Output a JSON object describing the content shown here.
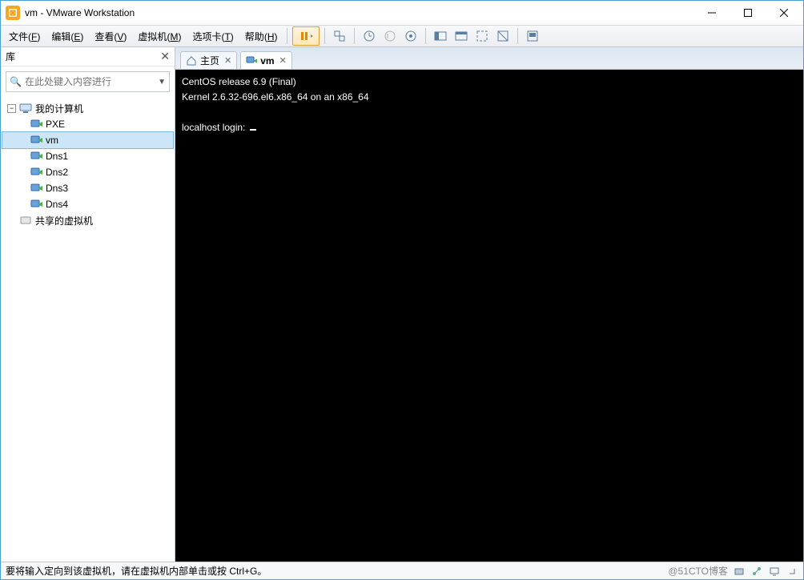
{
  "window": {
    "title": "vm - VMware Workstation"
  },
  "menu": {
    "items": [
      {
        "label": "文件",
        "accel": "F"
      },
      {
        "label": "编辑",
        "accel": "E"
      },
      {
        "label": "查看",
        "accel": "V"
      },
      {
        "label": "虚拟机",
        "accel": "M"
      },
      {
        "label": "选项卡",
        "accel": "T"
      },
      {
        "label": "帮助",
        "accel": "H"
      }
    ]
  },
  "sidebar": {
    "title": "库",
    "search_placeholder": "在此处键入内容进行",
    "root": {
      "label": "我的计算机"
    },
    "vms": [
      {
        "label": "PXE"
      },
      {
        "label": "vm",
        "selected": true
      },
      {
        "label": "Dns1"
      },
      {
        "label": "Dns2"
      },
      {
        "label": "Dns3"
      },
      {
        "label": "Dns4"
      }
    ],
    "shared": {
      "label": "共享的虚拟机"
    }
  },
  "tabs": [
    {
      "label": "主页",
      "icon": "home",
      "active": false
    },
    {
      "label": "vm",
      "icon": "vm",
      "active": true
    }
  ],
  "terminal": {
    "lines": [
      "CentOS release 6.9 (Final)",
      "Kernel 2.6.32-696.el6.x86_64 on an x86_64",
      "",
      "localhost login: "
    ]
  },
  "statusbar": {
    "message": "要将输入定向到该虚拟机，请在虚拟机内部单击或按 Ctrl+G。",
    "watermark": "@51CTO博客"
  }
}
